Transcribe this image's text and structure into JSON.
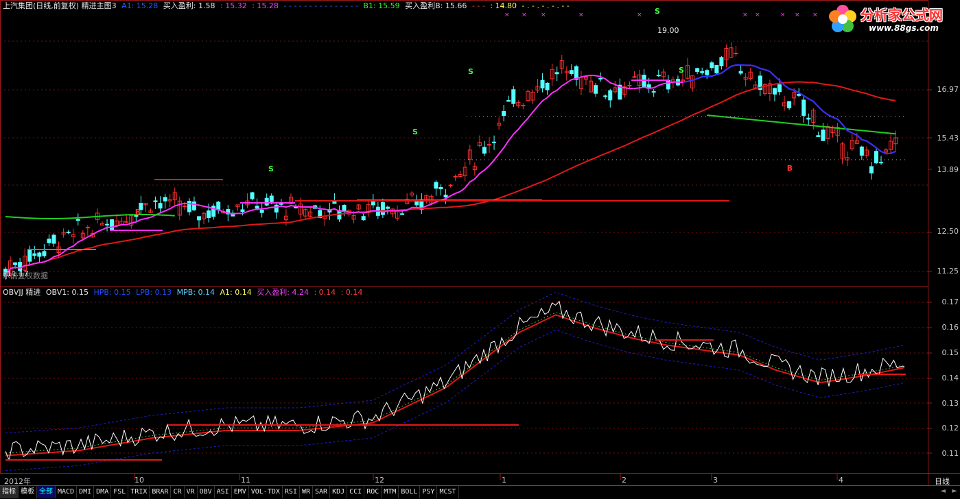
{
  "main_header": {
    "title": "上汽集团(日线,前复权) 精进主图3",
    "a1_label": "A1: 15.28",
    "buy_profit_label": "买入盈利: 1.58",
    "v1": ": 15.32",
    "v2": ": 15.28",
    "dashes1": "- - - - - - - - - - - - - - -",
    "b1_label": "B1: 15.59",
    "buy_profit_b_label": "买入盈利B: 15.66",
    "dashes2": "- - -",
    "v3": ": 14.80",
    "dashes3": "- . - . - . - . - -"
  },
  "main_overlay_text": "示前复权数据",
  "peak_label": "19.00",
  "low_label": "11.17",
  "price_axis": [
    "16.97",
    "15.43",
    "13.89",
    "12.50",
    "11.25"
  ],
  "sub_header": {
    "name": "OBVJJ 精进",
    "obv1": "OBV1: 0.15",
    "hpb": "HPB: 0.15",
    "lpb": "LPB: 0.13",
    "mpb": "MPB: 0.14",
    "a1": "A1: 0.14",
    "buy_profit": "买入盈利: 4.24",
    "v1": ": 0.14",
    "v2": ": 0.14"
  },
  "sub_axis": [
    "0.17",
    "0.16",
    "0.15",
    "0.14",
    "0.13",
    "0.12",
    "0.11"
  ],
  "date_axis": [
    {
      "label": "2012年"
    },
    {
      "label": "10"
    },
    {
      "label": "11"
    },
    {
      "label": "12"
    },
    {
      "label": "1"
    },
    {
      "label": "2"
    },
    {
      "label": "3"
    },
    {
      "label": "4"
    }
  ],
  "period_label": "日线",
  "markers": {
    "sell": "S",
    "buy": "B"
  },
  "logo": {
    "text": "分析家公式网",
    "url_text": "www.88gs.com"
  },
  "tabs": [
    "指标",
    "模板",
    "全部",
    "MACD",
    "DMI",
    "DMA",
    "FSL",
    "TRIX",
    "BRAR",
    "CR",
    "VR",
    "OBV",
    "ASI",
    "EMV",
    "VOL-TDX",
    "RSI",
    "WR",
    "SAR",
    "KDJ",
    "CCI",
    "ROC",
    "MTM",
    "BOLL",
    "PSY",
    "MCST"
  ],
  "nav": {
    "left": "◄",
    "right": "►"
  },
  "colors": {
    "background": "#000000",
    "frame": "#a01818",
    "up_candle": "#ff3030",
    "down_candle": "#54ffff",
    "ma_green": "#20d020",
    "ma_red": "#e01818",
    "ma_magenta": "#ff30ff",
    "ma_blue": "#3030ff",
    "obv_white": "#ffffff",
    "obv_yellow": "#ffff80",
    "band_blue": "#2020d0"
  }
}
